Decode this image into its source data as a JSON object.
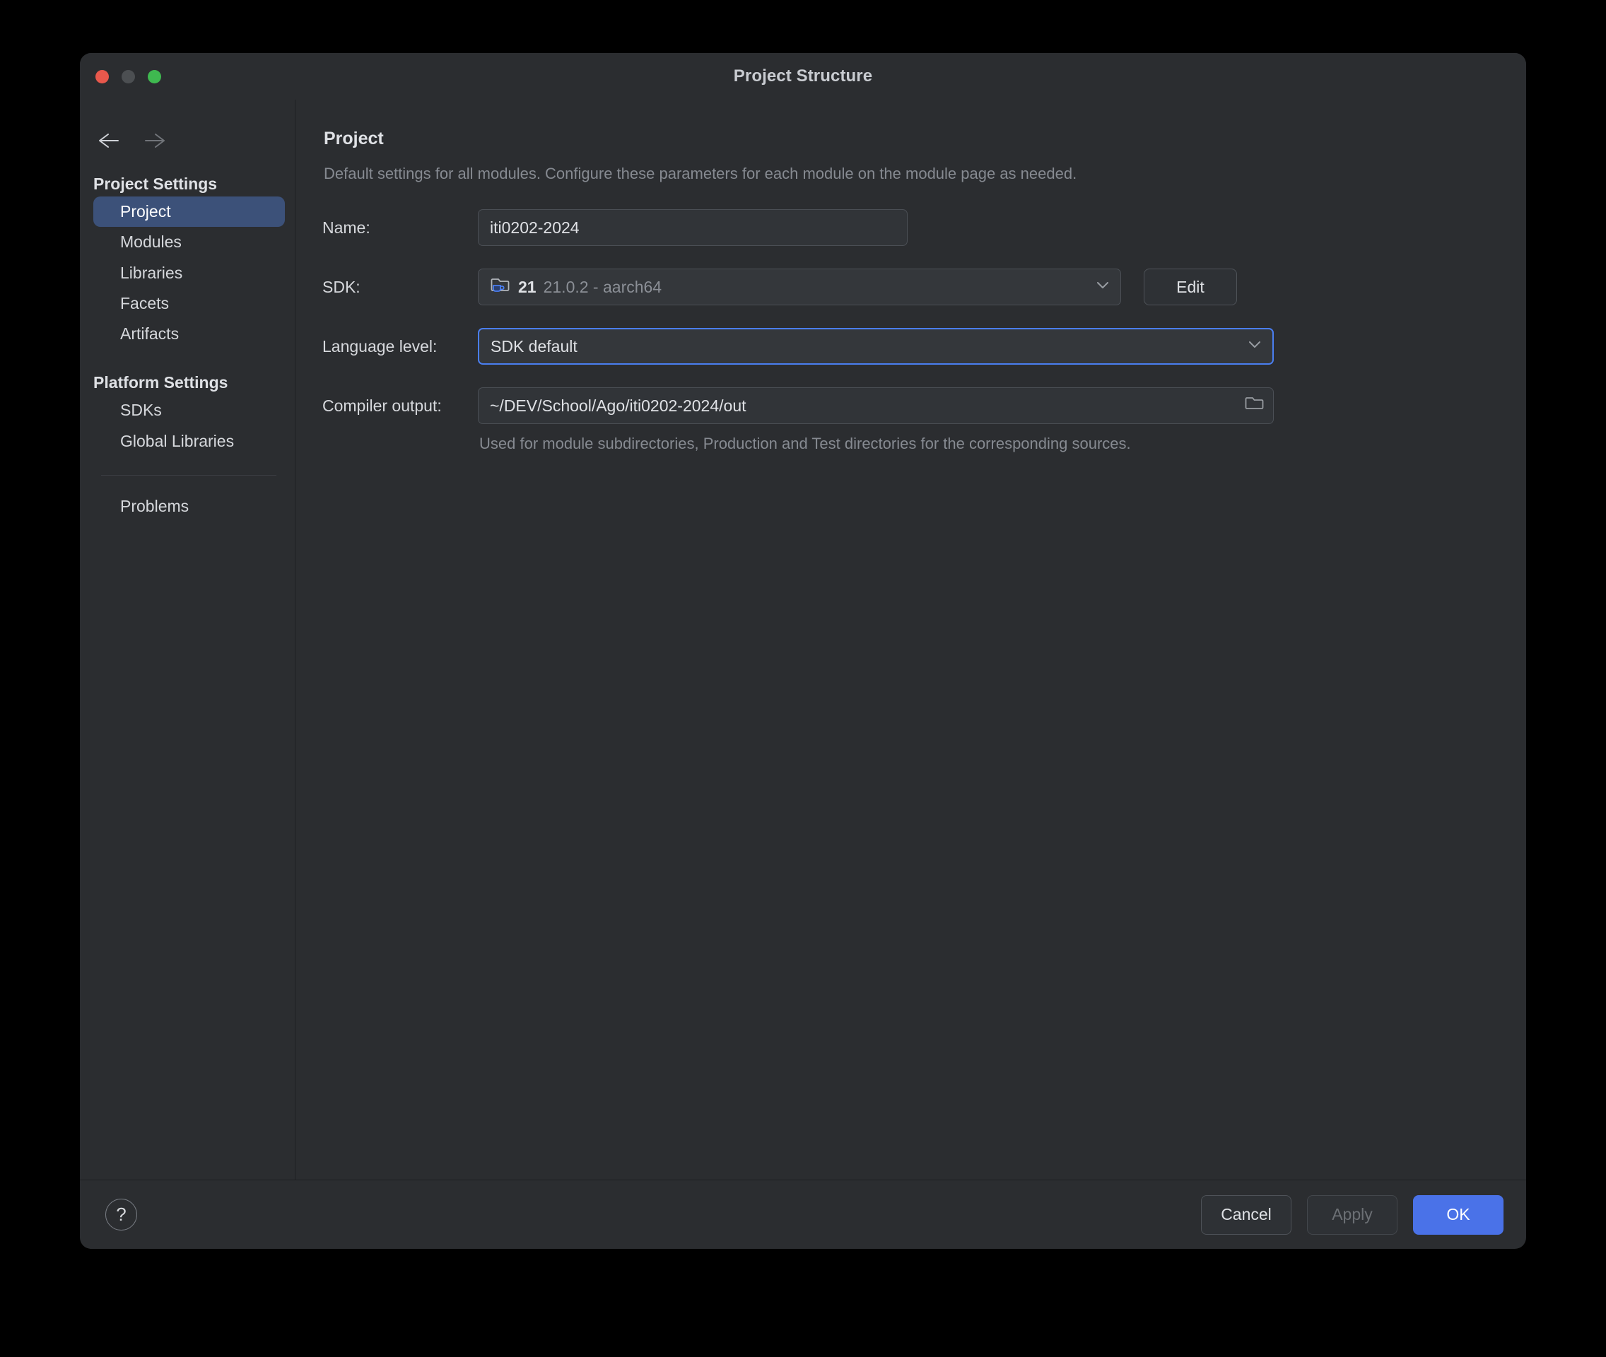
{
  "window": {
    "title": "Project Structure",
    "traffic_lights": [
      "close",
      "minimize",
      "zoom"
    ]
  },
  "nav": {
    "back": "back-arrow",
    "forward": "forward-arrow"
  },
  "sidebar": {
    "groups": [
      {
        "header": "Project Settings",
        "items": [
          {
            "label": "Project",
            "selected": true
          },
          {
            "label": "Modules",
            "selected": false
          },
          {
            "label": "Libraries",
            "selected": false
          },
          {
            "label": "Facets",
            "selected": false
          },
          {
            "label": "Artifacts",
            "selected": false
          }
        ]
      },
      {
        "header": "Platform Settings",
        "items": [
          {
            "label": "SDKs",
            "selected": false
          },
          {
            "label": "Global Libraries",
            "selected": false
          }
        ]
      }
    ],
    "problems": "Problems"
  },
  "content": {
    "title": "Project",
    "subtitle": "Default settings for all modules. Configure these parameters for each module on the module page as needed.",
    "fields": {
      "name": {
        "label": "Name:",
        "value": "iti0202-2024"
      },
      "sdk": {
        "label": "SDK:",
        "version": "21",
        "detail": "21.0.2 - aarch64",
        "edit_label": "Edit"
      },
      "language_level": {
        "label": "Language level:",
        "value": "SDK default"
      },
      "compiler_output": {
        "label": "Compiler output:",
        "value": "~/DEV/School/Ago/iti0202-2024/out",
        "helper": "Used for module subdirectories, Production and Test directories for the corresponding sources."
      }
    }
  },
  "footer": {
    "help": "?",
    "cancel": "Cancel",
    "apply": "Apply",
    "ok": "OK"
  },
  "colors": {
    "window_bg": "#2b2d30",
    "selection_blue": "#3c5179",
    "focus_blue": "#4a7ef0",
    "primary_button": "#4a72e8",
    "java_badge": "#4a7ef0"
  }
}
